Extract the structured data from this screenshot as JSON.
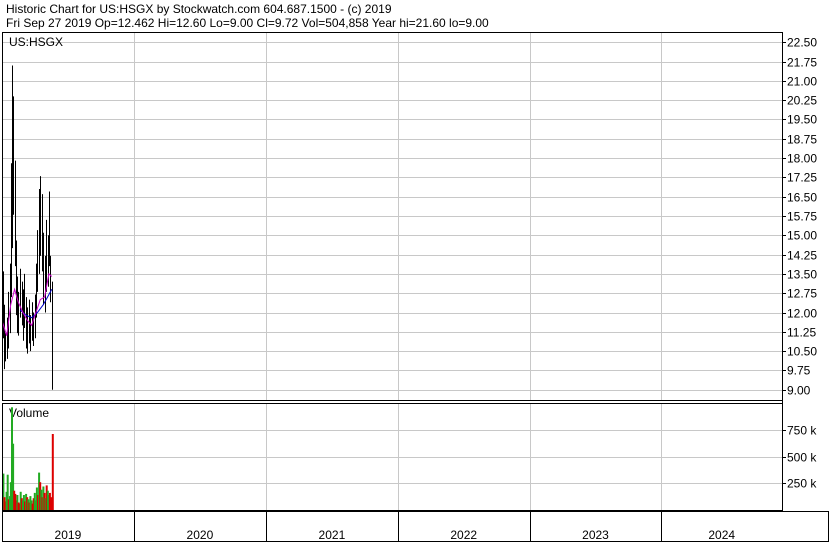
{
  "header": {
    "line1": "Historic Chart for US:HSGX by Stockwatch.com 604.687.1500 - (c) 2019",
    "line2": "Fri Sep 27 2019  Op=12.462  Hi=12.60  Lo=9.00  Cl=9.72  Vol=504,858  Year hi=21.60  lo=9.00"
  },
  "colors": {
    "price": "#000000",
    "ma_short": "#cc00cc",
    "ma_long": "#0000cc",
    "volume_up": "#22aa22",
    "volume_down": "#dd0000",
    "grid": "#c8c8c8",
    "border": "#000000"
  },
  "chart_data": [
    {
      "type": "line",
      "panel": "price",
      "symbol_label": "US:HSGX",
      "ylim": [
        8.6,
        22.9
      ],
      "yticks": [
        "22.50",
        "21.75",
        "21.00",
        "20.25",
        "19.50",
        "18.75",
        "18.00",
        "17.25",
        "16.50",
        "15.75",
        "15.00",
        "14.25",
        "13.50",
        "12.75",
        "12.00",
        "11.25",
        "10.50",
        "9.75",
        "9.00"
      ],
      "x_range": [
        "2019-01-01",
        "2024-11-30"
      ],
      "series": [
        {
          "kind": "hl_bars",
          "points": [
            {
              "date": "2019-01-03",
              "high": 13.6,
              "low": 11.0
            },
            {
              "date": "2019-01-07",
              "high": 12.3,
              "low": 9.8
            },
            {
              "date": "2019-01-10",
              "high": 11.2,
              "low": 10.1
            },
            {
              "date": "2019-01-14",
              "high": 11.8,
              "low": 10.2
            },
            {
              "date": "2019-01-17",
              "high": 12.8,
              "low": 10.6
            },
            {
              "date": "2019-01-22",
              "high": 13.9,
              "low": 11.2
            },
            {
              "date": "2019-01-25",
              "high": 17.8,
              "low": 12.6
            },
            {
              "date": "2019-01-29",
              "high": 21.6,
              "low": 14.5
            },
            {
              "date": "2019-02-01",
              "high": 20.4,
              "low": 15.8
            },
            {
              "date": "2019-02-05",
              "high": 17.9,
              "low": 13.8
            },
            {
              "date": "2019-02-08",
              "high": 14.8,
              "low": 11.9
            },
            {
              "date": "2019-02-12",
              "high": 13.4,
              "low": 11.2
            },
            {
              "date": "2019-02-15",
              "high": 12.8,
              "low": 11.1
            },
            {
              "date": "2019-02-20",
              "high": 13.7,
              "low": 11.8
            },
            {
              "date": "2019-02-24",
              "high": 13.2,
              "low": 11.5
            },
            {
              "date": "2019-02-28",
              "high": 12.9,
              "low": 10.9
            },
            {
              "date": "2019-03-04",
              "high": 13.5,
              "low": 11.4
            },
            {
              "date": "2019-03-08",
              "high": 12.6,
              "low": 10.6
            },
            {
              "date": "2019-03-12",
              "high": 12.2,
              "low": 10.4
            },
            {
              "date": "2019-03-16",
              "high": 12.5,
              "low": 10.8
            },
            {
              "date": "2019-03-20",
              "high": 11.9,
              "low": 10.5
            },
            {
              "date": "2019-03-24",
              "high": 12.4,
              "low": 10.9
            },
            {
              "date": "2019-03-28",
              "high": 12.0,
              "low": 10.7
            },
            {
              "date": "2019-04-01",
              "high": 12.7,
              "low": 11.0
            },
            {
              "date": "2019-04-05",
              "high": 13.9,
              "low": 11.8
            },
            {
              "date": "2019-04-09",
              "high": 15.2,
              "low": 12.8
            },
            {
              "date": "2019-04-13",
              "high": 16.8,
              "low": 13.5
            },
            {
              "date": "2019-04-17",
              "high": 17.3,
              "low": 14.2
            },
            {
              "date": "2019-04-21",
              "high": 16.6,
              "low": 13.6
            },
            {
              "date": "2019-04-25",
              "high": 15.1,
              "low": 12.3
            },
            {
              "date": "2019-04-29",
              "high": 14.2,
              "low": 12.0
            },
            {
              "date": "2019-05-03",
              "high": 15.6,
              "low": 12.8
            },
            {
              "date": "2019-05-07",
              "high": 15.0,
              "low": 13.0
            },
            {
              "date": "2019-05-11",
              "high": 16.7,
              "low": 13.8
            },
            {
              "date": "2019-05-15",
              "high": 14.2,
              "low": 12.4
            },
            {
              "date": "2019-05-19",
              "high": 13.2,
              "low": 9.0
            }
          ]
        },
        {
          "kind": "ma_short",
          "points": [
            {
              "date": "2019-01-03",
              "value": 11.6
            },
            {
              "date": "2019-01-14",
              "value": 11.1
            },
            {
              "date": "2019-01-25",
              "value": 12.3
            },
            {
              "date": "2019-02-05",
              "value": 12.9
            },
            {
              "date": "2019-02-15",
              "value": 12.4
            },
            {
              "date": "2019-02-28",
              "value": 12.0
            },
            {
              "date": "2019-03-12",
              "value": 11.7
            },
            {
              "date": "2019-03-24",
              "value": 11.5
            },
            {
              "date": "2019-04-05",
              "value": 12.0
            },
            {
              "date": "2019-04-17",
              "value": 12.5
            },
            {
              "date": "2019-04-29",
              "value": 12.6
            },
            {
              "date": "2019-05-11",
              "value": 13.5
            },
            {
              "date": "2019-05-19",
              "value": 13.4
            }
          ]
        },
        {
          "kind": "ma_long",
          "points": [
            {
              "date": "2019-02-20",
              "value": 12.1
            },
            {
              "date": "2019-03-08",
              "value": 11.9
            },
            {
              "date": "2019-03-24",
              "value": 11.8
            },
            {
              "date": "2019-04-09",
              "value": 12.0
            },
            {
              "date": "2019-04-25",
              "value": 12.3
            },
            {
              "date": "2019-05-07",
              "value": 12.6
            },
            {
              "date": "2019-05-19",
              "value": 12.9
            }
          ]
        }
      ]
    },
    {
      "type": "bar",
      "panel": "volume",
      "title": "Volume",
      "ylim": [
        0,
        1000000
      ],
      "yticks": [
        {
          "value": 750000,
          "label": "750 k"
        },
        {
          "value": 500000,
          "label": "500 k"
        },
        {
          "value": 250000,
          "label": "250 k"
        }
      ],
      "bars": [
        {
          "date": "2019-01-02",
          "value": 340000,
          "dir": "up"
        },
        {
          "date": "2019-01-05",
          "value": 120000,
          "dir": "down"
        },
        {
          "date": "2019-01-08",
          "value": 80000,
          "dir": "down"
        },
        {
          "date": "2019-01-11",
          "value": 170000,
          "dir": "up"
        },
        {
          "date": "2019-01-14",
          "value": 330000,
          "dir": "up"
        },
        {
          "date": "2019-01-17",
          "value": 100000,
          "dir": "down"
        },
        {
          "date": "2019-01-20",
          "value": 130000,
          "dir": "up"
        },
        {
          "date": "2019-01-23",
          "value": 260000,
          "dir": "up"
        },
        {
          "date": "2019-01-26",
          "value": 960000,
          "dir": "up"
        },
        {
          "date": "2019-01-29",
          "value": 620000,
          "dir": "up"
        },
        {
          "date": "2019-02-01",
          "value": 180000,
          "dir": "down"
        },
        {
          "date": "2019-02-04",
          "value": 150000,
          "dir": "down"
        },
        {
          "date": "2019-02-07",
          "value": 90000,
          "dir": "down"
        },
        {
          "date": "2019-02-10",
          "value": 140000,
          "dir": "up"
        },
        {
          "date": "2019-02-13",
          "value": 70000,
          "dir": "down"
        },
        {
          "date": "2019-02-16",
          "value": 60000,
          "dir": "down"
        },
        {
          "date": "2019-02-19",
          "value": 170000,
          "dir": "up"
        },
        {
          "date": "2019-02-22",
          "value": 110000,
          "dir": "down"
        },
        {
          "date": "2019-02-25",
          "value": 90000,
          "dir": "up"
        },
        {
          "date": "2019-02-28",
          "value": 140000,
          "dir": "up"
        },
        {
          "date": "2019-03-03",
          "value": 80000,
          "dir": "down"
        },
        {
          "date": "2019-03-06",
          "value": 150000,
          "dir": "up"
        },
        {
          "date": "2019-03-09",
          "value": 120000,
          "dir": "down"
        },
        {
          "date": "2019-03-12",
          "value": 100000,
          "dir": "up"
        },
        {
          "date": "2019-03-15",
          "value": 70000,
          "dir": "down"
        },
        {
          "date": "2019-03-18",
          "value": 130000,
          "dir": "up"
        },
        {
          "date": "2019-03-21",
          "value": 90000,
          "dir": "up"
        },
        {
          "date": "2019-03-24",
          "value": 60000,
          "dir": "down"
        },
        {
          "date": "2019-03-27",
          "value": 110000,
          "dir": "down"
        },
        {
          "date": "2019-03-30",
          "value": 160000,
          "dir": "up"
        },
        {
          "date": "2019-04-02",
          "value": 90000,
          "dir": "up"
        },
        {
          "date": "2019-04-05",
          "value": 210000,
          "dir": "up"
        },
        {
          "date": "2019-04-08",
          "value": 140000,
          "dir": "down"
        },
        {
          "date": "2019-04-11",
          "value": 350000,
          "dir": "up"
        },
        {
          "date": "2019-04-14",
          "value": 260000,
          "dir": "down"
        },
        {
          "date": "2019-04-17",
          "value": 190000,
          "dir": "up"
        },
        {
          "date": "2019-04-20",
          "value": 120000,
          "dir": "down"
        },
        {
          "date": "2019-04-23",
          "value": 220000,
          "dir": "up"
        },
        {
          "date": "2019-04-26",
          "value": 160000,
          "dir": "down"
        },
        {
          "date": "2019-04-29",
          "value": 110000,
          "dir": "up"
        },
        {
          "date": "2019-05-02",
          "value": 230000,
          "dir": "down"
        },
        {
          "date": "2019-05-05",
          "value": 180000,
          "dir": "up"
        },
        {
          "date": "2019-05-08",
          "value": 140000,
          "dir": "up"
        },
        {
          "date": "2019-05-11",
          "value": 160000,
          "dir": "down"
        },
        {
          "date": "2019-05-15",
          "value": 120000,
          "dir": "down"
        },
        {
          "date": "2019-05-19",
          "value": 710000,
          "dir": "down"
        }
      ]
    }
  ],
  "x_axis": {
    "years": [
      {
        "label": "2019",
        "start": "2019-01-01",
        "end": "2020-01-01"
      },
      {
        "label": "2020",
        "start": "2020-01-01",
        "end": "2021-01-01"
      },
      {
        "label": "2021",
        "start": "2021-01-01",
        "end": "2022-01-01"
      },
      {
        "label": "2022",
        "start": "2022-01-01",
        "end": "2023-01-01"
      },
      {
        "label": "2023",
        "start": "2023-01-01",
        "end": "2024-01-01"
      },
      {
        "label": "2024",
        "start": "2024-01-01",
        "end": "2024-11-30"
      }
    ]
  }
}
